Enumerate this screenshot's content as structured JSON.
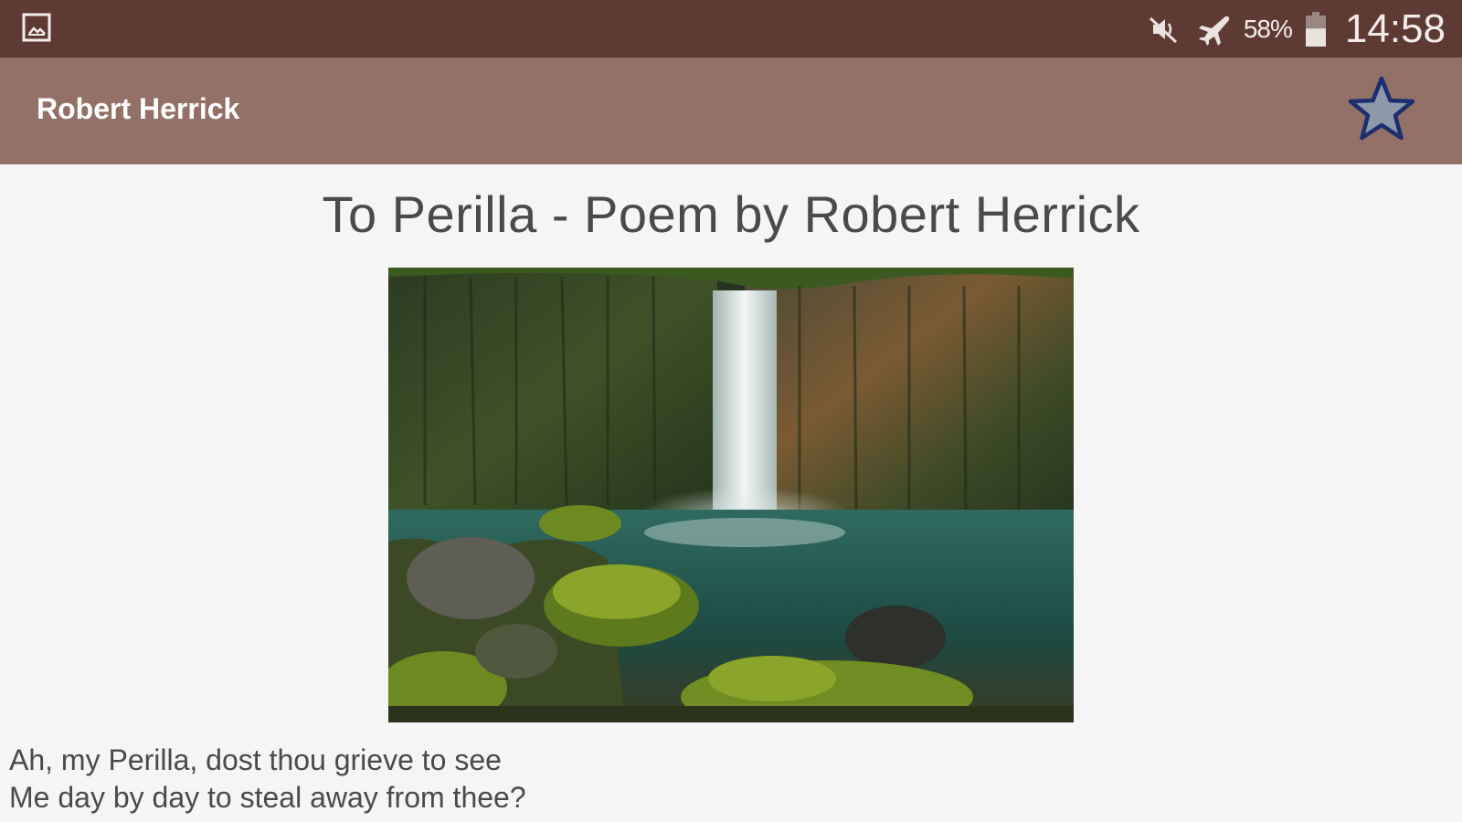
{
  "status_bar": {
    "left_icon": "gallery-icon",
    "icons": [
      "mute-icon",
      "airplane-mode-icon",
      "battery-icon"
    ],
    "battery_percent": "58%",
    "battery_level": 0.58,
    "time": "14:58"
  },
  "app_bar": {
    "title": "Robert Herrick",
    "favorite_icon": "star-icon"
  },
  "poem": {
    "title": "To Perilla - Poem by Robert Herrick",
    "image_icon": "waterfall-image",
    "lines": [
      "Ah, my Perilla, dost thou grieve to see",
      "Me day by day to steal away from thee?"
    ]
  },
  "colors": {
    "status_bar": "#5d3b33",
    "app_bar": "#937166",
    "background": "#f5f5f5",
    "text": "#4a4a4a",
    "star_fill": "#8c99a8",
    "star_outline": "#1c2f6e"
  }
}
